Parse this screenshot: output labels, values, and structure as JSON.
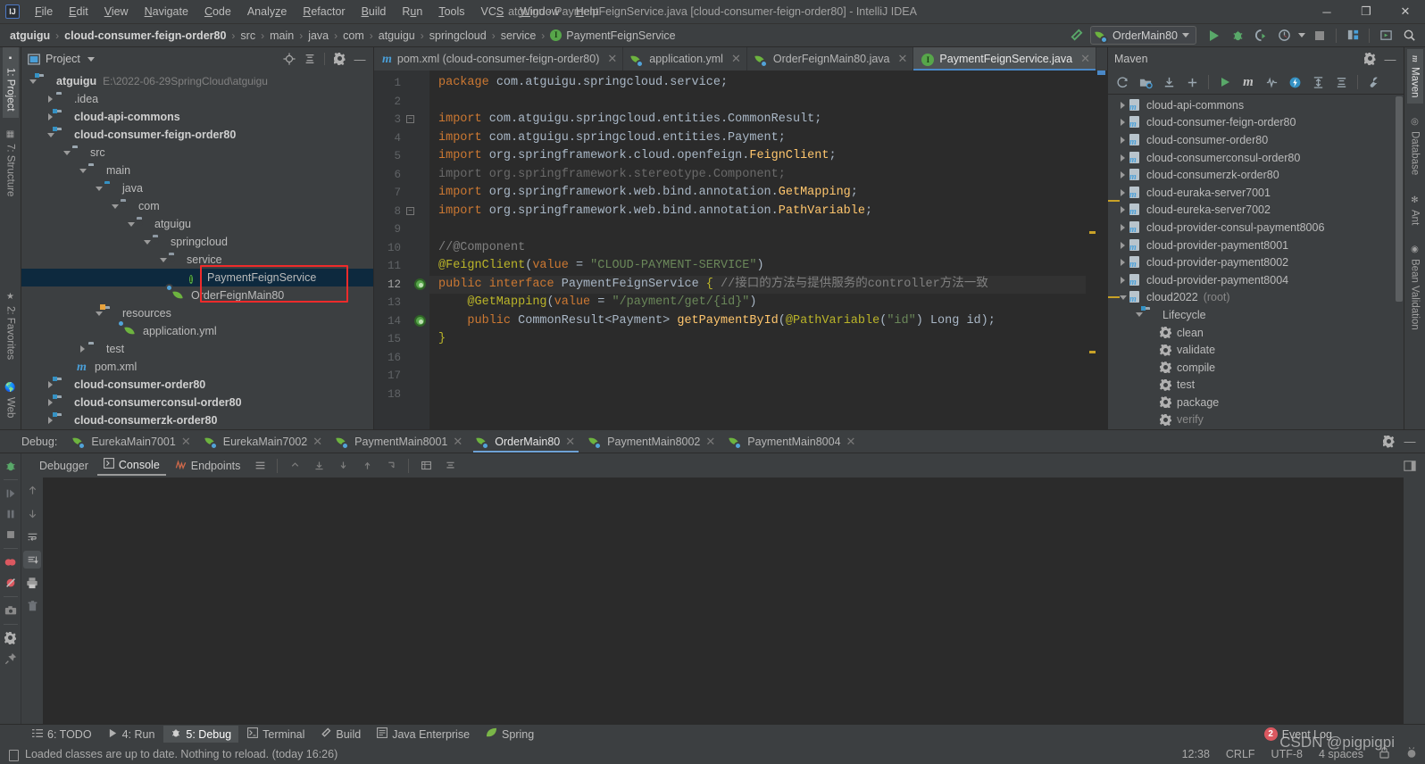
{
  "window": {
    "title": "atguigu - PaymentFeignService.java [cloud-consumer-feign-order80] - IntelliJ IDEA",
    "logo": "IJ",
    "minimize": "─",
    "maximize": "❐",
    "close": "✕"
  },
  "menubar": [
    {
      "label": "File"
    },
    {
      "label": "Edit"
    },
    {
      "label": "View"
    },
    {
      "label": "Navigate"
    },
    {
      "label": "Code"
    },
    {
      "label": "Analyze"
    },
    {
      "label": "Refactor"
    },
    {
      "label": "Build"
    },
    {
      "label": "Run"
    },
    {
      "label": "Tools"
    },
    {
      "label": "VCS"
    },
    {
      "label": "Window"
    },
    {
      "label": "Help"
    }
  ],
  "breadcrumb": {
    "items": [
      {
        "label": "atguigu",
        "bold": true
      },
      {
        "label": "cloud-consumer-feign-order80",
        "bold": true
      },
      {
        "label": "src"
      },
      {
        "label": "main"
      },
      {
        "label": "java"
      },
      {
        "label": "com"
      },
      {
        "label": "atguigu"
      },
      {
        "label": "springcloud"
      },
      {
        "label": "service"
      },
      {
        "label": "PaymentFeignService",
        "icon": "interface-icon"
      }
    ],
    "separator": "›"
  },
  "toolbar": {
    "build_icon": "hammer-icon",
    "run_config": "OrderMain80",
    "run_icon": "run-icon",
    "debug_icon": "debug-icon",
    "run_coverage_icon": "run-with-coverage-icon",
    "profiler_icon": "profiler-icon",
    "stop_icon": "stop-icon",
    "project_structure_icon": "project-structure-icon",
    "updates_icon": "updates-icon",
    "search_icon": "search-everywhere-icon"
  },
  "left_strip": [
    {
      "label": "1: Project",
      "active": true,
      "icon": "project-icon"
    },
    {
      "label": "7: Structure",
      "active": false,
      "icon": "structure-icon"
    },
    {
      "label": "2: Favorites",
      "active": false,
      "icon": "star-icon"
    },
    {
      "label": "Web",
      "active": false,
      "icon": "web-icon"
    }
  ],
  "project_panel": {
    "title": "Project",
    "icons": [
      "locate-icon",
      "collapse-all-icon",
      "settings-icon",
      "hide-icon"
    ],
    "tree": [
      {
        "depth": 0,
        "twisty": "down",
        "icon": "module-folder",
        "label": "atguigu",
        "bold": true,
        "path": "E:\\2022-06-29SpringCloud\\atguigu"
      },
      {
        "depth": 1,
        "twisty": "right",
        "icon": "folder",
        "label": ".idea",
        "bold": false
      },
      {
        "depth": 1,
        "twisty": "right",
        "icon": "module-folder",
        "label": "cloud-api-commons",
        "bold": true
      },
      {
        "depth": 1,
        "twisty": "down",
        "icon": "module-folder",
        "label": "cloud-consumer-feign-order80",
        "bold": true
      },
      {
        "depth": 2,
        "twisty": "down",
        "icon": "folder",
        "label": "src",
        "bold": false
      },
      {
        "depth": 3,
        "twisty": "down",
        "icon": "folder",
        "label": "main",
        "bold": false
      },
      {
        "depth": 4,
        "twisty": "down",
        "icon": "source-folder",
        "label": "java",
        "bold": false
      },
      {
        "depth": 5,
        "twisty": "down",
        "icon": "package",
        "label": "com",
        "bold": false
      },
      {
        "depth": 6,
        "twisty": "down",
        "icon": "package",
        "label": "atguigu",
        "bold": false
      },
      {
        "depth": 7,
        "twisty": "down",
        "icon": "package",
        "label": "springcloud",
        "bold": false
      },
      {
        "depth": 8,
        "twisty": "down",
        "icon": "package",
        "label": "service",
        "bold": false
      },
      {
        "depth": 9,
        "twisty": "none",
        "icon": "interface-icon",
        "label": "PaymentFeignService",
        "bold": false,
        "selected": true
      },
      {
        "depth": 8,
        "twisty": "none",
        "icon": "spring-boot-icon",
        "label": "OrderFeignMain80",
        "bold": false
      },
      {
        "depth": 4,
        "twisty": "down",
        "icon": "resource-folder",
        "label": "resources",
        "bold": false
      },
      {
        "depth": 5,
        "twisty": "none",
        "icon": "spring-yaml-icon",
        "label": "application.yml",
        "bold": false
      },
      {
        "depth": 3,
        "twisty": "right",
        "icon": "folder",
        "label": "test",
        "bold": false
      },
      {
        "depth": 2,
        "twisty": "none",
        "icon": "maven-icon",
        "label": "pom.xml",
        "bold": false
      },
      {
        "depth": 1,
        "twisty": "right",
        "icon": "module-folder",
        "label": "cloud-consumer-order80",
        "bold": true
      },
      {
        "depth": 1,
        "twisty": "right",
        "icon": "module-folder",
        "label": "cloud-consumerconsul-order80",
        "bold": true
      },
      {
        "depth": 1,
        "twisty": "right",
        "icon": "module-folder",
        "label": "cloud-consumerzk-order80",
        "bold": true
      }
    ]
  },
  "editor_tabs": [
    {
      "label": "pom.xml (cloud-consumer-feign-order80)",
      "icon": "maven-icon",
      "active": false
    },
    {
      "label": "application.yml",
      "icon": "spring-yaml-icon",
      "active": false
    },
    {
      "label": "OrderFeignMain80.java",
      "icon": "spring-boot-icon",
      "active": false
    },
    {
      "label": "PaymentFeignService.java",
      "icon": "interface-icon",
      "active": true
    }
  ],
  "editor": {
    "lines": [
      {
        "n": 1,
        "fold": false,
        "gutter_mark": false,
        "hl": false,
        "tokens": [
          {
            "t": "k",
            "v": "package"
          },
          {
            "t": "t",
            "v": " com.atguigu.springcloud.service;"
          }
        ]
      },
      {
        "n": 2,
        "fold": false,
        "gutter_mark": false,
        "hl": false,
        "tokens": []
      },
      {
        "n": 3,
        "fold": "open",
        "gutter_mark": false,
        "hl": false,
        "tokens": [
          {
            "t": "k",
            "v": "import"
          },
          {
            "t": "t",
            "v": " com.atguigu.springcloud.entities."
          },
          {
            "t": "t",
            "v": "CommonResult"
          },
          {
            "t": "t",
            "v": ";"
          }
        ]
      },
      {
        "n": 4,
        "fold": false,
        "gutter_mark": false,
        "hl": false,
        "tokens": [
          {
            "t": "k",
            "v": "import"
          },
          {
            "t": "t",
            "v": " com.atguigu.springcloud.entities."
          },
          {
            "t": "t",
            "v": "Payment"
          },
          {
            "t": "t",
            "v": ";"
          }
        ]
      },
      {
        "n": 5,
        "fold": false,
        "gutter_mark": false,
        "hl": false,
        "tokens": [
          {
            "t": "k",
            "v": "import"
          },
          {
            "t": "t",
            "v": " org.springframework.cloud.openfeign."
          },
          {
            "t": "m",
            "v": "FeignClient"
          },
          {
            "t": "t",
            "v": ";"
          }
        ]
      },
      {
        "n": 6,
        "fold": false,
        "gutter_mark": false,
        "hl": false,
        "tokens": [
          {
            "t": "dim",
            "v": "import org.springframework.stereotype.Component;"
          }
        ]
      },
      {
        "n": 7,
        "fold": false,
        "gutter_mark": false,
        "hl": false,
        "tokens": [
          {
            "t": "k",
            "v": "import"
          },
          {
            "t": "t",
            "v": " org.springframework.web.bind.annotation."
          },
          {
            "t": "m",
            "v": "GetMapping"
          },
          {
            "t": "t",
            "v": ";"
          }
        ]
      },
      {
        "n": 8,
        "fold": "close",
        "gutter_mark": false,
        "hl": false,
        "tokens": [
          {
            "t": "k",
            "v": "import"
          },
          {
            "t": "t",
            "v": " org.springframework.web.bind.annotation."
          },
          {
            "t": "m",
            "v": "PathVariable"
          },
          {
            "t": "t",
            "v": ";"
          }
        ]
      },
      {
        "n": 9,
        "fold": false,
        "gutter_mark": false,
        "hl": false,
        "tokens": []
      },
      {
        "n": 10,
        "fold": false,
        "gutter_mark": false,
        "hl": false,
        "tokens": [
          {
            "t": "c",
            "v": "//@Component"
          }
        ]
      },
      {
        "n": 11,
        "fold": false,
        "gutter_mark": false,
        "hl": false,
        "tokens": [
          {
            "t": "an",
            "v": "@FeignClient"
          },
          {
            "t": "t",
            "v": "("
          },
          {
            "t": "k",
            "v": "value"
          },
          {
            "t": "t",
            "v": " = "
          },
          {
            "t": "s",
            "v": "\"CLOUD-PAYMENT-SERVICE\""
          },
          {
            "t": "t",
            "v": ")"
          }
        ]
      },
      {
        "n": 12,
        "fold": false,
        "gutter_mark": true,
        "hl": true,
        "tokens": [
          {
            "t": "k",
            "v": "public"
          },
          {
            "t": "t",
            "v": " "
          },
          {
            "t": "k",
            "v": "interface"
          },
          {
            "t": "t",
            "v": " "
          },
          {
            "t": "t",
            "v": "PaymentFeignService"
          },
          {
            "t": "t",
            "v": " "
          },
          {
            "t": "cursor",
            "v": "{"
          },
          {
            "t": "c",
            "v": " //接口的方法与提供服务的controller方法一致"
          }
        ]
      },
      {
        "n": 13,
        "fold": false,
        "gutter_mark": false,
        "hl": false,
        "tokens": [
          {
            "t": "t",
            "v": "    "
          },
          {
            "t": "an",
            "v": "@GetMapping"
          },
          {
            "t": "t",
            "v": "("
          },
          {
            "t": "k",
            "v": "value"
          },
          {
            "t": "t",
            "v": " = "
          },
          {
            "t": "s",
            "v": "\"/payment/get/{id}\""
          },
          {
            "t": "t",
            "v": ")"
          }
        ]
      },
      {
        "n": 14,
        "fold": false,
        "gutter_mark": true,
        "hl": false,
        "tokens": [
          {
            "t": "t",
            "v": "    "
          },
          {
            "t": "k",
            "v": "public"
          },
          {
            "t": "t",
            "v": " CommonResult<Payment> "
          },
          {
            "t": "m",
            "v": "getPaymentById"
          },
          {
            "t": "t",
            "v": "("
          },
          {
            "t": "an",
            "v": "@PathVariable"
          },
          {
            "t": "t",
            "v": "("
          },
          {
            "t": "s",
            "v": "\"id\""
          },
          {
            "t": "t",
            "v": ") Long id);"
          }
        ]
      },
      {
        "n": 15,
        "fold": false,
        "gutter_mark": false,
        "hl": false,
        "tokens": [
          {
            "t": "an",
            "v": "}"
          }
        ]
      },
      {
        "n": 16,
        "fold": false,
        "gutter_mark": false,
        "hl": false,
        "tokens": []
      },
      {
        "n": 17,
        "fold": false,
        "gutter_mark": false,
        "hl": false,
        "tokens": []
      },
      {
        "n": 18,
        "fold": false,
        "gutter_mark": false,
        "hl": false,
        "tokens": []
      }
    ]
  },
  "maven_panel": {
    "title": "Maven",
    "header_icons": [
      "settings-icon",
      "hide-icon"
    ],
    "toolbar_icons": [
      "reload-icon",
      "add-maven-projects-icon",
      "download-sources-icon",
      "add-icon",
      "run-icon",
      "maven-m-icon",
      "toggle-skip-tests-icon",
      "execute-goal-icon",
      "expand-all-icon",
      "collapse-all-icon",
      "settings-wrench-icon"
    ],
    "tree": [
      {
        "depth": 0,
        "twisty": "right",
        "icon": "maven-project",
        "label": "cloud-api-commons"
      },
      {
        "depth": 0,
        "twisty": "right",
        "icon": "maven-project",
        "label": "cloud-consumer-feign-order80"
      },
      {
        "depth": 0,
        "twisty": "right",
        "icon": "maven-project",
        "label": "cloud-consumer-order80"
      },
      {
        "depth": 0,
        "twisty": "right",
        "icon": "maven-project",
        "label": "cloud-consumerconsul-order80"
      },
      {
        "depth": 0,
        "twisty": "right",
        "icon": "maven-project",
        "label": "cloud-consumerzk-order80"
      },
      {
        "depth": 0,
        "twisty": "right",
        "icon": "maven-project",
        "label": "cloud-euraka-server7001"
      },
      {
        "depth": 0,
        "twisty": "right",
        "icon": "maven-project",
        "label": "cloud-eureka-server7002"
      },
      {
        "depth": 0,
        "twisty": "right",
        "icon": "maven-project",
        "label": "cloud-provider-consul-payment8006"
      },
      {
        "depth": 0,
        "twisty": "right",
        "icon": "maven-project",
        "label": "cloud-provider-payment8001"
      },
      {
        "depth": 0,
        "twisty": "right",
        "icon": "maven-project",
        "label": "cloud-provider-payment8002"
      },
      {
        "depth": 0,
        "twisty": "right",
        "icon": "maven-project",
        "label": "cloud-provider-payment8004"
      },
      {
        "depth": 0,
        "twisty": "down",
        "icon": "maven-project",
        "label": "cloud2022",
        "suffix": "(root)"
      },
      {
        "depth": 1,
        "twisty": "down",
        "icon": "lifecycle-folder",
        "label": "Lifecycle"
      },
      {
        "depth": 2,
        "twisty": "none",
        "icon": "goal-icon",
        "label": "clean"
      },
      {
        "depth": 2,
        "twisty": "none",
        "icon": "goal-icon",
        "label": "validate"
      },
      {
        "depth": 2,
        "twisty": "none",
        "icon": "goal-icon",
        "label": "compile"
      },
      {
        "depth": 2,
        "twisty": "none",
        "icon": "goal-icon",
        "label": "test"
      },
      {
        "depth": 2,
        "twisty": "none",
        "icon": "goal-icon",
        "label": "package"
      },
      {
        "depth": 2,
        "twisty": "none",
        "icon": "goal-icon",
        "label": "verify"
      }
    ]
  },
  "right_strip": [
    {
      "label": "Maven",
      "active": true,
      "icon": "maven-icon"
    },
    {
      "label": "Database",
      "active": false,
      "icon": "database-icon"
    },
    {
      "label": "Ant",
      "active": false,
      "icon": "ant-icon"
    },
    {
      "label": "Bean Validation",
      "active": false,
      "icon": "bean-validation-icon"
    }
  ],
  "debug_panel": {
    "label": "Debug:",
    "tabs": [
      {
        "label": "EurekaMain7001",
        "active": false
      },
      {
        "label": "EurekaMain7002",
        "active": false
      },
      {
        "label": "PaymentMain8001",
        "active": false
      },
      {
        "label": "OrderMain80",
        "active": true
      },
      {
        "label": "PaymentMain8002",
        "active": false
      },
      {
        "label": "PaymentMain8004",
        "active": false
      }
    ],
    "header_icons": [
      "settings-icon",
      "hide-icon"
    ],
    "subtabs": [
      {
        "label": "Debugger",
        "active": false,
        "icon": "debugger-icon"
      },
      {
        "label": "Console",
        "active": true,
        "icon": "console-icon"
      },
      {
        "label": "Endpoints",
        "active": false,
        "icon": "endpoints-icon"
      }
    ],
    "sidebar_icons": [
      "rerun-debug-icon",
      "resume-icon",
      "pause-icon",
      "stop-icon",
      "mute-breakpoints-icon",
      "view-breakpoints-icon",
      "camera-icon",
      "settings-icon",
      "pin-icon"
    ],
    "console_icons": [
      "up-icon",
      "down-icon",
      "soft-wrap-icon",
      "scroll-to-end-icon",
      "print-icon",
      "trash-icon"
    ]
  },
  "toolwindow_bar": [
    {
      "label": "6: TODO",
      "icon": "todo-icon",
      "active": false
    },
    {
      "label": "4: Run",
      "icon": "run-icon",
      "active": false
    },
    {
      "label": "5: Debug",
      "icon": "debug-icon",
      "active": true
    },
    {
      "label": "Terminal",
      "icon": "terminal-icon",
      "active": false
    },
    {
      "label": "Build",
      "icon": "build-icon",
      "active": false
    },
    {
      "label": "Java Enterprise",
      "icon": "java-enterprise-icon",
      "active": false
    },
    {
      "label": "Spring",
      "icon": "spring-icon",
      "active": false
    }
  ],
  "statusbar": {
    "message": "Loaded classes are up to date. Nothing to reload. (today 16:26)",
    "time": "12:38",
    "line_ending": "CRLF",
    "encoding": "UTF-8",
    "indent": "4 spaces",
    "event_log": "Event Log",
    "event_log_count": "2",
    "watermark": "CSDN @pigpigpi"
  },
  "colors": {
    "accent": "#4a88c7",
    "selection": "#0d293e",
    "highlight_box": "#ef2b2b",
    "green": "#59a869",
    "panel_bg": "#3c3f41",
    "editor_bg": "#2b2b2b"
  }
}
